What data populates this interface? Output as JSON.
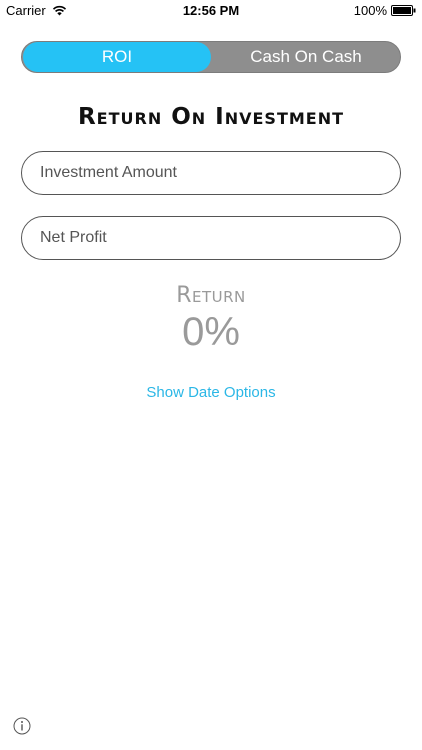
{
  "status_bar": {
    "carrier": "Carrier",
    "time": "12:56 PM",
    "battery": "100%"
  },
  "segmented": {
    "roi_label": "ROI",
    "coc_label": "Cash On Cash",
    "selected": "ROI"
  },
  "title": "Return On Investment",
  "fields": {
    "investment_placeholder": "Investment Amount",
    "investment_value": "",
    "profit_placeholder": "Net Profit",
    "profit_value": ""
  },
  "result": {
    "label": "Return",
    "value": "0%"
  },
  "date_options_label": "Show Date Options",
  "icons": {
    "wifi": "wifi-icon",
    "battery": "battery-icon",
    "info": "info-icon"
  },
  "colors": {
    "accent": "#25c2f5",
    "segment_bg": "#8e8e8e",
    "link": "#2bb7e6",
    "result_text": "#9a9a9a"
  }
}
